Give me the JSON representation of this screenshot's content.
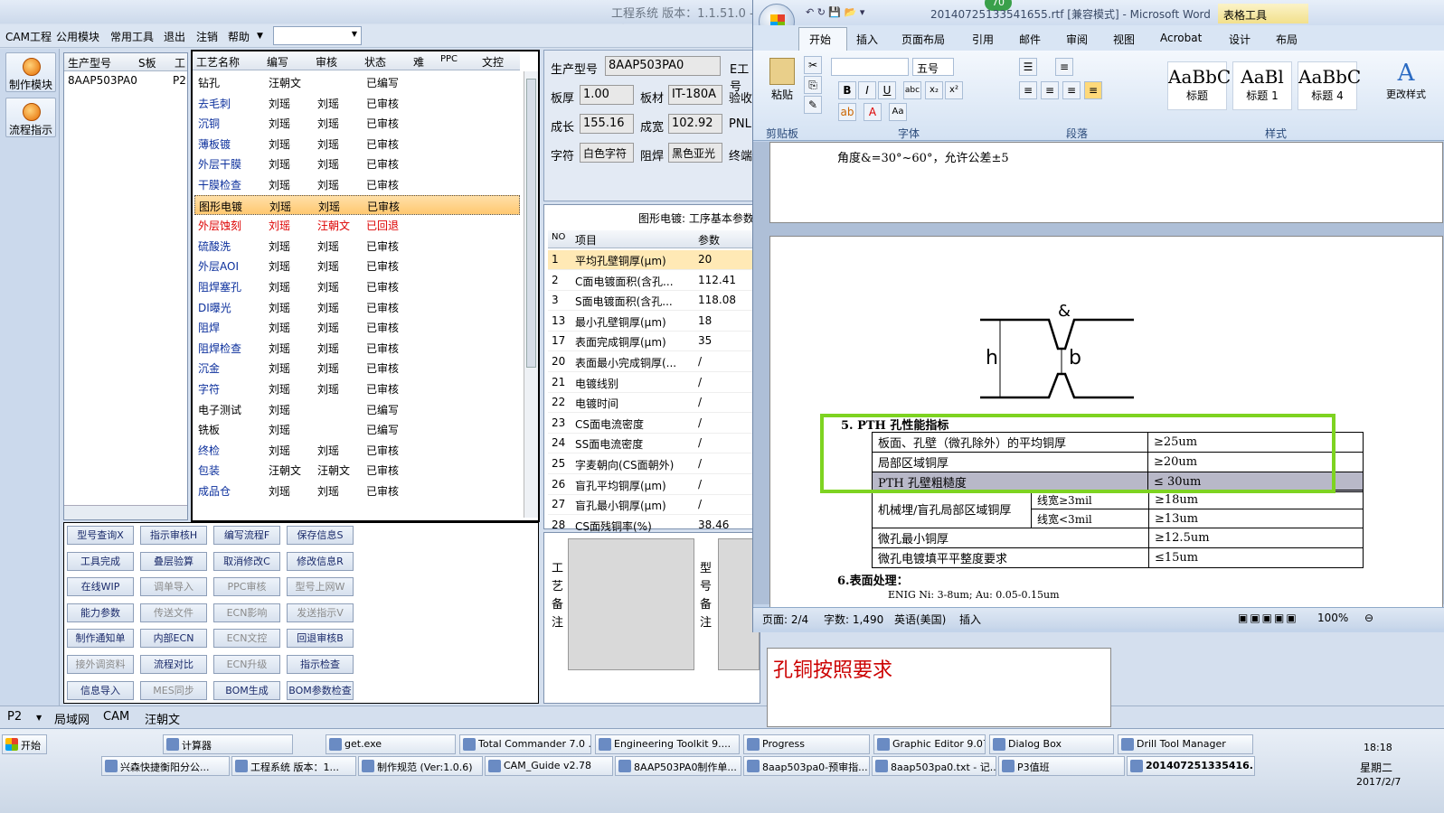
{
  "app": {
    "title": "工程系统  版本：1.1.51.0 - [流",
    "menu": [
      "CAM工程",
      "公用模块",
      "常用工具",
      "退出",
      "注销",
      "帮助"
    ],
    "left_buttons": [
      "制作模块",
      "流程指示"
    ]
  },
  "models": {
    "headers": [
      "生产型号",
      "S板",
      "工"
    ],
    "rows": [
      [
        "8AAP503PA0",
        "P2"
      ]
    ]
  },
  "process": {
    "headers": [
      "工艺名称",
      "编写",
      "审核",
      "状态",
      "难",
      "PPC",
      "文控"
    ],
    "rows": [
      {
        "name": "钻孔",
        "writer": "汪朝文",
        "reviewer": "",
        "status": "已编写",
        "type": "black"
      },
      {
        "name": "去毛刺",
        "writer": "刘瑶",
        "reviewer": "刘瑶",
        "status": "已审核",
        "type": "blue"
      },
      {
        "name": "沉铜",
        "writer": "刘瑶",
        "reviewer": "刘瑶",
        "status": "已审核",
        "type": "blue"
      },
      {
        "name": "薄板镀",
        "writer": "刘瑶",
        "reviewer": "刘瑶",
        "status": "已审核",
        "type": "blue"
      },
      {
        "name": "外层干膜",
        "writer": "刘瑶",
        "reviewer": "刘瑶",
        "status": "已审核",
        "type": "blue"
      },
      {
        "name": "干膜检查",
        "writer": "刘瑶",
        "reviewer": "刘瑶",
        "status": "已审核",
        "type": "blue"
      },
      {
        "name": "图形电镀",
        "writer": "刘瑶",
        "reviewer": "刘瑶",
        "status": "已审核",
        "type": "sel"
      },
      {
        "name": "外层蚀刻",
        "writer": "刘瑶",
        "reviewer": "汪朝文",
        "status": "已回退",
        "type": "red"
      },
      {
        "name": "硫酸洗",
        "writer": "刘瑶",
        "reviewer": "刘瑶",
        "status": "已审核",
        "type": "blue"
      },
      {
        "name": "外层AOI",
        "writer": "刘瑶",
        "reviewer": "刘瑶",
        "status": "已审核",
        "type": "blue"
      },
      {
        "name": "阻焊塞孔",
        "writer": "刘瑶",
        "reviewer": "刘瑶",
        "status": "已审核",
        "type": "blue"
      },
      {
        "name": "DI曝光",
        "writer": "刘瑶",
        "reviewer": "刘瑶",
        "status": "已审核",
        "type": "blue"
      },
      {
        "name": "阻焊",
        "writer": "刘瑶",
        "reviewer": "刘瑶",
        "status": "已审核",
        "type": "blue"
      },
      {
        "name": "阻焊检查",
        "writer": "刘瑶",
        "reviewer": "刘瑶",
        "status": "已审核",
        "type": "blue"
      },
      {
        "name": "沉金",
        "writer": "刘瑶",
        "reviewer": "刘瑶",
        "status": "已审核",
        "type": "blue"
      },
      {
        "name": "字符",
        "writer": "刘瑶",
        "reviewer": "刘瑶",
        "status": "已审核",
        "type": "blue"
      },
      {
        "name": "电子测试",
        "writer": "刘瑶",
        "reviewer": "",
        "status": "已编写",
        "type": "black"
      },
      {
        "name": "铣板",
        "writer": "刘瑶",
        "reviewer": "",
        "status": "已编写",
        "type": "black"
      },
      {
        "name": "终检",
        "writer": "刘瑶",
        "reviewer": "刘瑶",
        "status": "已审核",
        "type": "blue"
      },
      {
        "name": "包装",
        "writer": "汪朝文",
        "reviewer": "汪朝文",
        "status": "已审核",
        "type": "blue"
      },
      {
        "name": "成品仓",
        "writer": "刘瑶",
        "reviewer": "刘瑶",
        "status": "已审核",
        "type": "blue"
      }
    ]
  },
  "buttons": [
    [
      "型号查询X",
      "指示审核H",
      "编写流程F",
      "保存信息S"
    ],
    [
      "工具完成",
      "叠层验算",
      "取消修改C",
      "修改信息R"
    ],
    [
      "在线WIP",
      "调单导入",
      "PPC审核",
      "型号上网W"
    ],
    [
      "能力参数",
      "传送文件",
      "ECN影响",
      "发送指示V"
    ],
    [
      "制作通知单",
      "内部ECN",
      "ECN文控",
      "回退审核B"
    ],
    [
      "接外调资料",
      "流程对比",
      "ECN升级",
      "指示检查"
    ],
    [
      "信息导入",
      "MES同步",
      "BOM生成",
      "BOM参数检查"
    ]
  ],
  "disabled_buttons": [
    "调单导入",
    "PPC审核",
    "型号上网W",
    "传送文件",
    "ECN影响",
    "发送指示V",
    "ECN文控",
    "接外调资料",
    "ECN升级",
    "MES同步"
  ],
  "detail": {
    "model_label": "生产型号",
    "model": "8AAP503PA0",
    "e_label": "E工号",
    "thick_label": "板厚",
    "thick": "1.00",
    "mat_label": "板材",
    "mat": "IT-180A",
    "check_label": "验收",
    "len_label": "成长",
    "len": "155.16",
    "wid_label": "成宽",
    "wid": "102.92",
    "pnl_label": "PNL",
    "char_label": "字符",
    "char": "白色字符",
    "mask_label": "阻焊",
    "mask": "黑色亚光",
    "end_label": "终端"
  },
  "params": {
    "title": "图形电镀: 工序基本参数",
    "headers": [
      "NO",
      "项目",
      "参数"
    ],
    "rows": [
      [
        "1",
        "平均孔壁铜厚(μm)",
        "20"
      ],
      [
        "2",
        "C面电镀面积(含孔...",
        "112.41"
      ],
      [
        "3",
        "S面电镀面积(含孔...",
        "118.08"
      ],
      [
        "13",
        "最小孔壁铜厚(μm)",
        "18"
      ],
      [
        "17",
        "表面完成铜厚(μm)",
        "35"
      ],
      [
        "20",
        "表面最小完成铜厚(...",
        "/"
      ],
      [
        "21",
        "电镀线别",
        "/"
      ],
      [
        "22",
        "电镀时间",
        "/"
      ],
      [
        "23",
        "CS面电流密度",
        "/"
      ],
      [
        "24",
        "SS面电流密度",
        "/"
      ],
      [
        "25",
        "字麦朝向(CS面朝外)",
        "/"
      ],
      [
        "26",
        "盲孔平均铜厚(μm)",
        "/"
      ],
      [
        "27",
        "盲孔最小铜厚(μm)",
        "/"
      ],
      [
        "28",
        "CS面残铜率(%)",
        "38.46"
      ]
    ]
  },
  "notes": {
    "proc_label": "工艺备注",
    "model_label": "型号备注"
  },
  "status": {
    "p2": "P2",
    "net": "局域网",
    "cam": "CAM",
    "user": "汪朝文"
  },
  "word": {
    "title": "20140725133541655.rtf [兼容模式] - Microsoft Word",
    "table_tools": "表格工具",
    "badge": "70",
    "tabs": [
      "开始",
      "插入",
      "页面布局",
      "引用",
      "邮件",
      "审阅",
      "视图",
      "Acrobat",
      "设计",
      "布局"
    ],
    "groups": [
      "剪贴板",
      "字体",
      "段落",
      "样式"
    ],
    "paste": "粘贴",
    "font_size": "五号",
    "styles": [
      {
        "sample": "AaBbC",
        "name": "标题"
      },
      {
        "sample": "AaBl",
        "name": "标题 1"
      },
      {
        "sample": "AaBbC",
        "name": "标题 4"
      }
    ],
    "change_styles": "更改样式",
    "doc_top_text": "角度&=30°~60°，允许公差±5",
    "fig": {
      "h": "h",
      "b": "b",
      "amp": "&"
    },
    "sec5": "5. PTH 孔性能指标",
    "table": [
      [
        "板面、孔壁（微孔除外）的平均铜厚",
        "≥25um"
      ],
      [
        "局部区域铜厚",
        "≥20um"
      ],
      [
        "PTH 孔壁粗糙度",
        "≤ 30um"
      ]
    ],
    "table2": {
      "label": "机械埋/盲孔局部区域铜厚",
      "sub1": "线宽≥3mil",
      "v1": "≥18um",
      "sub2": "线宽<3mil",
      "v2": "≥13um"
    },
    "table3": [
      [
        "微孔最小铜厚",
        "≥12.5um"
      ],
      [
        "微孔电镀填平平整度要求",
        "≤15um"
      ]
    ],
    "sec6": "6.表面处理：",
    "sec6_sub": "ENIG      Ni: 3-8um; Au: 0.05-0.15um",
    "status": {
      "page": "页面: 2/4",
      "words": "字数: 1,490",
      "lang": "英语(美国)",
      "mode": "插入",
      "zoom": "100%"
    }
  },
  "popup": "孔铜按照要求",
  "taskbar": {
    "start": "开始",
    "row1": [
      "计算器",
      "get.exe",
      "Total Commander 7.0 ...",
      "Engineering Toolkit 9....",
      "Progress",
      "Graphic Editor 9.07b2 ...",
      "Dialog Box",
      "Drill Tool Manager"
    ],
    "row2": [
      "兴森快捷衡阳分公...",
      "工程系统  版本：1...",
      "制作规范 (Ver:1.0.6)",
      "CAM_Guide v2.78",
      "8AAP503PA0制作单...",
      "8aap503pa0-预审指...",
      "8aap503pa0.txt - 记...",
      "P3值班",
      "201407251335416..."
    ],
    "time": "18:18",
    "weekday": "星期二",
    "date": "2017/2/7"
  },
  "colors": {
    "accent": "#ffc870",
    "highlight": "#7ed321",
    "red": "#d00000",
    "blue": "#0b2f9c"
  }
}
